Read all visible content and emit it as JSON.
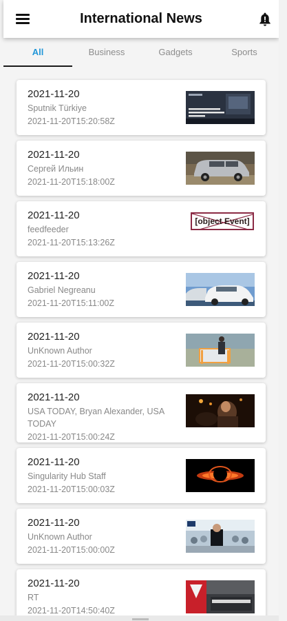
{
  "header": {
    "title": "International News",
    "menu_icon": "hamburger-menu-icon",
    "bell_icon": "notification-bell-icon"
  },
  "tabs": [
    {
      "label": "All",
      "active": true
    },
    {
      "label": "Business",
      "active": false
    },
    {
      "label": "Gadgets",
      "active": false
    },
    {
      "label": "Sports",
      "active": false
    }
  ],
  "colors": {
    "accent": "#2196d8",
    "indicator": "#1a1a1a",
    "broken_border": "#8b2a44"
  },
  "articles": [
    {
      "date": "2021-11-20",
      "author": "Sputnik Türkiye",
      "timestamp": "2021-11-20T15:20:58Z",
      "image": "screen-with-text"
    },
    {
      "date": "2021-11-20",
      "author": "Сергей Ильин",
      "timestamp": "2021-11-20T15:18:00Z",
      "image": "silver-suv"
    },
    {
      "date": "2021-11-20",
      "author": "feedfeeder",
      "timestamp": "2021-11-20T15:13:26Z",
      "image": "broken",
      "image_alt": "[object Event]"
    },
    {
      "date": "2021-11-20",
      "author": "Gabriel Negreanu",
      "timestamp": "2021-11-20T15:11:00Z",
      "image": "white-car"
    },
    {
      "date": "2021-11-20",
      "author": "UnKnown Author",
      "timestamp": "2021-11-20T15:00:32Z",
      "image": "man-with-screen"
    },
    {
      "date": "2021-11-20",
      "author": "USA TODAY, Bryan Alexander, USA TODAY",
      "timestamp": "2021-11-20T15:00:24Z",
      "image": "dark-scene"
    },
    {
      "date": "2021-11-20",
      "author": "Singularity Hub Staff",
      "timestamp": "2021-11-20T15:00:03Z",
      "image": "black-hole"
    },
    {
      "date": "2021-11-20",
      "author": "UnKnown Author",
      "timestamp": "2021-11-20T15:00:00Z",
      "image": "crowd-factory"
    },
    {
      "date": "2021-11-20",
      "author": "RT",
      "timestamp": "2021-11-20T14:50:40Z",
      "image": "tesla-store"
    }
  ]
}
